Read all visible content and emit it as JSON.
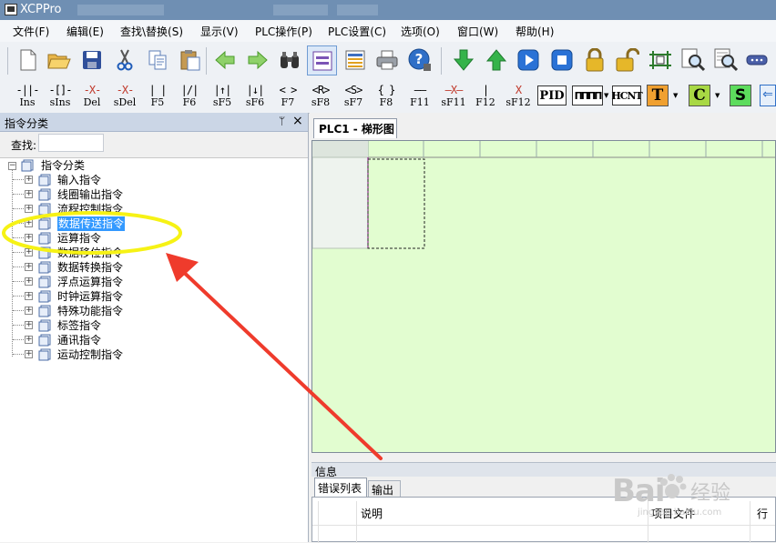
{
  "app": {
    "title": "XCPPro"
  },
  "menu": [
    "文件(F)",
    "编辑(E)",
    "查找\\替换(S)",
    "显示(V)",
    "PLC操作(P)",
    "PLC设置(C)",
    "选项(O)",
    "窗口(W)",
    "帮助(H)"
  ],
  "toolbar1": {
    "icons": [
      "new-file-icon",
      "open-folder-icon",
      "save-icon",
      "cut-icon",
      "copy-icon",
      "paste-icon",
      "undo-arrow-icon",
      "redo-arrow-icon",
      "find-binoculars-icon",
      "ladder-view-icon",
      "list-view-icon",
      "print-icon",
      "help-icon",
      "download-icon",
      "upload-icon",
      "run-icon",
      "stop-icon",
      "lock-icon",
      "unlock-icon",
      "monitor-icon",
      "zoom-doc-icon",
      "zoom-list-icon",
      "serial-port-icon"
    ]
  },
  "toolbar2": {
    "ladder_buttons": [
      {
        "symbol": "-||-",
        "label": "Ins"
      },
      {
        "symbol": "-[]-",
        "label": "sIns"
      },
      {
        "symbol": "-X-",
        "label": "Del"
      },
      {
        "symbol": "-X-",
        "label": "sDel"
      },
      {
        "symbol": "| |",
        "label": "F5"
      },
      {
        "symbol": "|/|",
        "label": "F6"
      },
      {
        "symbol": "|↑|",
        "label": "sF5"
      },
      {
        "symbol": "|↓|",
        "label": "sF6"
      },
      {
        "symbol": "< >",
        "label": "F7"
      },
      {
        "symbol": "<R>",
        "label": "sF8"
      },
      {
        "symbol": "<S>",
        "label": "sF7"
      },
      {
        "symbol": "{ }",
        "label": "F8"
      },
      {
        "symbol": "——",
        "label": "F11"
      },
      {
        "symbol": "—X—",
        "label": "sF11"
      },
      {
        "symbol": "|",
        "label": "F12"
      },
      {
        "symbol": "X",
        "label": "sF12"
      }
    ],
    "box_buttons": [
      "PID",
      "ПППП",
      "HCNT",
      "T",
      "C",
      "S"
    ]
  },
  "panel": {
    "title": "指令分类",
    "pin": "ᛘ",
    "close": "×",
    "search_label": "查找:",
    "search_value": "",
    "tree": {
      "root": "指令分类",
      "items": [
        "输入指令",
        "线圈输出指令",
        "流程控制指令",
        "数据传送指令",
        "运算指令",
        "数据移位指令",
        "数据转换指令",
        "浮点运算指令",
        "时钟运算指令",
        "特殊功能指令",
        "标签指令",
        "通讯指令",
        "运动控制指令"
      ],
      "selected_index": 3
    }
  },
  "document": {
    "tab": "PLC1 - 梯形图"
  },
  "info": {
    "title": "信息",
    "tabs": [
      "错误列表",
      "输出"
    ],
    "columns": [
      "说明",
      "项目文件",
      "行"
    ]
  },
  "watermark": {
    "brand": "Bai",
    "cn": "经验",
    "url": "jingyan.baidu.com"
  },
  "colors": {
    "editor_bg": "#e2fdd0",
    "annotation": "#f6f215",
    "arrow": "#ef3b2c",
    "selection": "#3399ff"
  }
}
